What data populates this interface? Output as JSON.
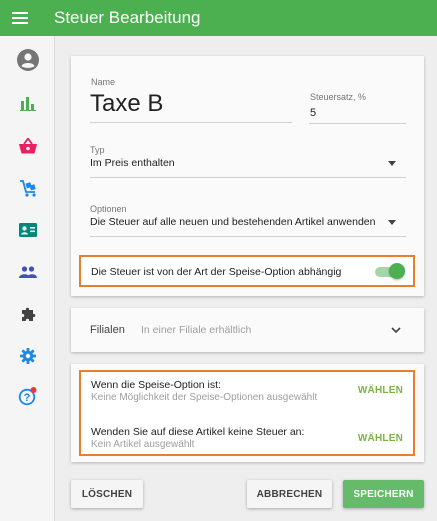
{
  "appbar": {
    "title": "Steuer Bearbeitung",
    "menu_icon": "menu-icon",
    "color": "#4caf50"
  },
  "sidebar": {
    "items": [
      {
        "name": "account-icon",
        "color": "#757575"
      },
      {
        "name": "bar-chart-icon",
        "color": "#4caf50"
      },
      {
        "name": "basket-icon",
        "color": "#e91e63"
      },
      {
        "name": "cart-icon",
        "color": "#1e88e5"
      },
      {
        "name": "contact-card-icon",
        "color": "#00897b"
      },
      {
        "name": "people-icon",
        "color": "#3f51b5"
      },
      {
        "name": "puzzle-icon",
        "color": "#424242"
      },
      {
        "name": "settings-icon",
        "color": "#1e88e5"
      },
      {
        "name": "help-icon",
        "color": "#1e88e5"
      }
    ]
  },
  "form": {
    "name_label": "Name",
    "name_value": "Taxe B",
    "rate_label": "Steuersatz, %",
    "rate_value": "5",
    "type_label": "Typ",
    "type_value": "Im Preis enthalten",
    "options_label": "Optionen",
    "options_value": "Die Steuer auf alle neuen und bestehenden Artikel anwenden",
    "toggle_label": "Die Steuer ist von der Art der Speise-Option abhängig",
    "toggle_on": true
  },
  "filialen": {
    "label": "Filialen",
    "value": "In einer Filiale erhältlich"
  },
  "speise_options": {
    "row1_title": "Wenn die Speise-Option ist:",
    "row1_sub": "Keine Möglichkeit der Speise-Optionen ausgewählt",
    "row2_title": "Wenden Sie auf diese Artikel keine Steuer an:",
    "row2_sub": "Kein Artikel ausgewählt",
    "choose_label": "WÄHLEN"
  },
  "footer": {
    "delete_label": "LÖSCHEN",
    "cancel_label": "ABBRECHEN",
    "save_label": "SPEICHERN"
  }
}
